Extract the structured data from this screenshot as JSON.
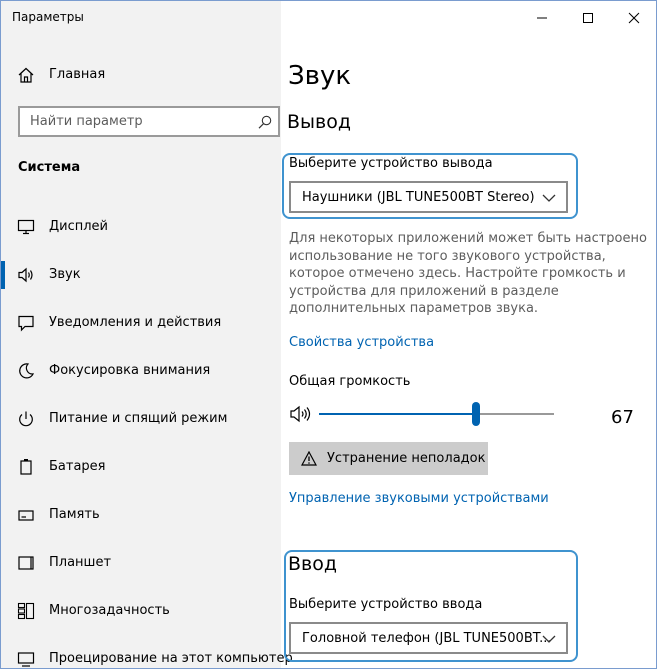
{
  "window": {
    "title": "Параметры",
    "minimize_label": "Свернуть",
    "maximize_label": "Развернуть",
    "close_label": "Закрыть"
  },
  "sidebar": {
    "home_label": "Главная",
    "search_placeholder": "Найти параметр",
    "section": "Система",
    "items": [
      {
        "label": "Дисплей",
        "icon": "display-icon"
      },
      {
        "label": "Звук",
        "icon": "sound-icon",
        "active": true
      },
      {
        "label": "Уведомления и действия",
        "icon": "notifications-icon"
      },
      {
        "label": "Фокусировка внимания",
        "icon": "focus-assist-icon"
      },
      {
        "label": "Питание и спящий режим",
        "icon": "power-icon"
      },
      {
        "label": "Батарея",
        "icon": "battery-icon"
      },
      {
        "label": "Память",
        "icon": "storage-icon"
      },
      {
        "label": "Планшет",
        "icon": "tablet-icon"
      },
      {
        "label": "Многозадачность",
        "icon": "multitasking-icon"
      },
      {
        "label": "Проецирование на этот компьютер",
        "icon": "projecting-icon"
      }
    ]
  },
  "main": {
    "page_title": "Звук",
    "output": {
      "heading": "Вывод",
      "device_label": "Выберите устройство вывода",
      "device_value": "Наушники (JBL TUNE500BT Stereo)",
      "description": "Для некоторых приложений может быть настроено использование не того звукового устройства, которое отмечено здесь. Настройте громкость и устройства для приложений в разделе дополнительных параметров звука.",
      "device_properties_link": "Свойства устройства",
      "volume_label": "Общая громкость",
      "volume_value": "67",
      "volume_fraction": 0.67,
      "troubleshoot_label": "Устранение неполадок",
      "manage_devices_link": "Управление звуковыми устройствами"
    },
    "input": {
      "heading": "Ввод",
      "device_label": "Выберите устройство ввода",
      "device_value": "Головной телефон (JBL TUNE500BT..."
    }
  },
  "colors": {
    "accent": "#0063b1",
    "focus_ring": "#3f93cf",
    "sidebar_bg": "#f2f2f2",
    "button_bg": "#cccccc"
  }
}
